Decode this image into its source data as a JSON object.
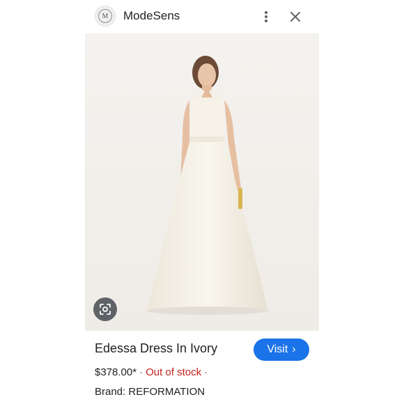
{
  "header": {
    "site_logo_letter": "M",
    "site_name": "ModeSens",
    "icons": {
      "more": "more-vert-icon",
      "close": "close-icon"
    }
  },
  "product": {
    "image_icon": "lens-icon",
    "title": "Edessa Dress In Ivory",
    "price": "$378.00*",
    "separator": "·",
    "stock_status": "Out of stock",
    "brand_label": "Brand:",
    "brand": "REFORMATION"
  },
  "actions": {
    "visit_label": "Visit",
    "visit_chevron": "›"
  },
  "colors": {
    "accent": "#1a73e8",
    "out_of_stock": "#c5221f",
    "text": "#202124"
  }
}
